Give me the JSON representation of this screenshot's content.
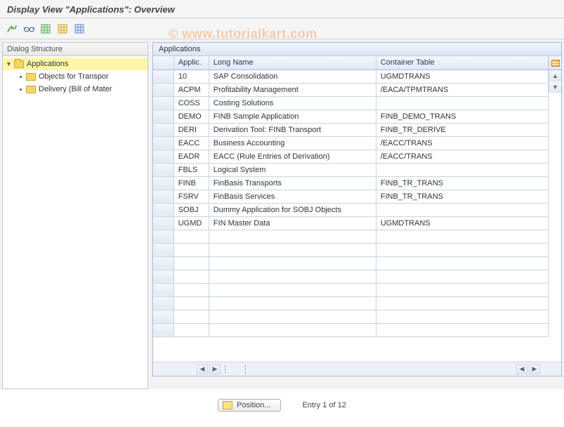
{
  "title": "Display View \"Applications\": Overview",
  "watermark": "© www.tutorialkart.com",
  "tree": {
    "header": "Dialog Structure",
    "root": {
      "label": "Applications",
      "selected": true
    },
    "children": [
      {
        "label": "Objects for Transpor"
      },
      {
        "label": "Delivery (Bill of Mater"
      }
    ]
  },
  "grid": {
    "title": "Applications",
    "columns": {
      "applic": "Applic.",
      "long": "Long Name",
      "cont": "Container Table"
    },
    "rows": [
      {
        "applic": "10",
        "long": "SAP Consolidation",
        "cont": "UGMDTRANS"
      },
      {
        "applic": "ACPM",
        "long": "Profitability Management",
        "cont": "/EACA/TPMTRANS"
      },
      {
        "applic": "COSS",
        "long": "Costing Solutions",
        "cont": ""
      },
      {
        "applic": "DEMO",
        "long": "FINB Sample Application",
        "cont": "FINB_DEMO_TRANS"
      },
      {
        "applic": "DERI",
        "long": "Derivation Tool: FINB Transport",
        "cont": "FINB_TR_DERIVE"
      },
      {
        "applic": "EACC",
        "long": "Business Accounting",
        "cont": "/EACC/TRANS"
      },
      {
        "applic": "EADR",
        "long": "EACC (Rule Entries of Derivation)",
        "cont": "/EACC/TRANS"
      },
      {
        "applic": "FBLS",
        "long": "Logical System",
        "cont": ""
      },
      {
        "applic": "FINB",
        "long": "FinBasis Transports",
        "cont": "FINB_TR_TRANS"
      },
      {
        "applic": "FSRV",
        "long": "FinBasis Services",
        "cont": "FINB_TR_TRANS"
      },
      {
        "applic": "SOBJ",
        "long": "Dummy Application for SOBJ Objects",
        "cont": ""
      },
      {
        "applic": "UGMD",
        "long": "FIN Master Data",
        "cont": "UGMDTRANS"
      }
    ],
    "empty_rows": 8
  },
  "footer": {
    "position_label": "Position...",
    "entry_text": "Entry 1 of 12"
  }
}
